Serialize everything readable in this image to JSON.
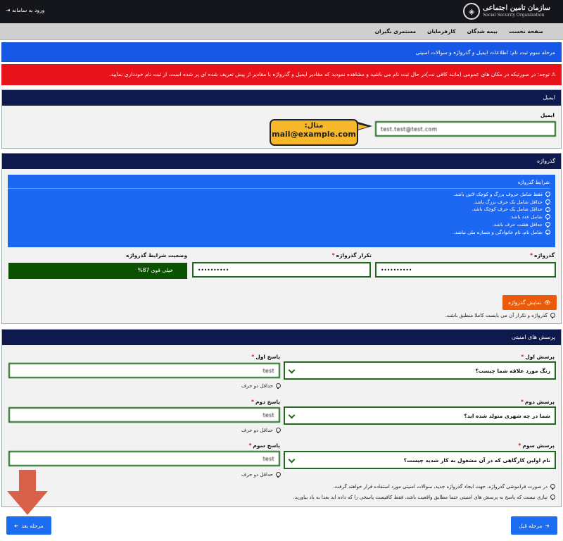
{
  "header": {
    "logo_fa": "سازمان تامین اجتماعی",
    "logo_en": "Social Security Organization",
    "login": "ورود به سامانه"
  },
  "nav": {
    "items": [
      "صفحه نخست",
      "بیمه شدگان",
      "کارفرمایان",
      "مستمری بگیران"
    ]
  },
  "banners": {
    "step": "مرحله سوم ثبت نام: اطلاعات ایمیل و گذرواژه و سوالات امنیتی",
    "alert": "توجه: در صورتیکه در مکان های عمومی (مانند کافی نت)در حال ثبت نام می باشید و مشاهده نمودید که مقادیر ایمیل و گذرواژه با مقادیر از پیش تعریف شده ای پر شده است، از ثبت نام خودداری نمایید."
  },
  "email_section": {
    "title": "ایمیل",
    "label": "ایمیل",
    "value": "test.test@test.com",
    "callout_line1": "مثال:",
    "callout_line2": "mail@example.com"
  },
  "password_section": {
    "title": "گذرواژه",
    "rules_title": "شرایط گذرواژه",
    "rules": [
      "فقط شامل حروف بزرگ و کوچک لاتین باشد.",
      "حداقل شامل یک حرف بزرگ باشد.",
      "حداقل شامل یک حرف کوچک باشد.",
      "شامل عدد باشد.",
      "حداقل هشت حرف باشد.",
      "شامل نام، نام خانوادگی و شماره ملی نباشد."
    ],
    "password_label": "گذرواژه",
    "password_value": "••••••••••",
    "confirm_label": "تکرار گذرواژه",
    "confirm_value": "••••••••••",
    "status_label": "وضعیت شرایط گذرواژه",
    "strength_text": "خیلی قوی",
    "strength_pct": "87%",
    "show_button": "نمایش گذرواژه",
    "match_note": "گذرواژه و تکرار آن می بایست کاملا منطبق باشند."
  },
  "security_section": {
    "title": "پرسش های امنیتی",
    "q1_label": "پرسش اول",
    "q1_value": "رنگ مورد علاقه شما چیست؟",
    "a1_label": "پاسخ اول",
    "a1_value": "test",
    "q2_label": "پرسش دوم",
    "q2_value": "شما در چه شهری متولد شده اید؟",
    "a2_label": "پاسخ دوم",
    "a2_value": "test",
    "q3_label": "پرسش سوم",
    "q3_value": "نام اولین کارگاهی که در آن مشغول به کار شدید چیست؟",
    "a3_label": "پاسخ سوم",
    "a3_value": "test",
    "min_hint": "حداقل دو حرف",
    "note1": "در صورت فراموشی گذرواژه، جهت ایجاد گذرواژه جدید، سوالات امنیتی مورد استفاده قرار خواهند گرفت.",
    "note2": "نیازی نیست که پاسخ به پرسش های امنیتی حتما مطابق واقعیت باشد، فقط کافیست پاسخی را که داده اید بعدا به یاد بیاورید."
  },
  "footer": {
    "prev": "مرحله قبل",
    "next": "مرحله بعد"
  },
  "colors": {
    "primary_blue": "#1758e6",
    "alert_red": "#e8121a",
    "panel_header": "#0e1a4e",
    "input_border": "#1f6a1f",
    "show_button": "#ea5a08",
    "strength_bar": "#0a5200",
    "callout": "#f6b72a",
    "annotation_arrow": "#d9604a"
  }
}
